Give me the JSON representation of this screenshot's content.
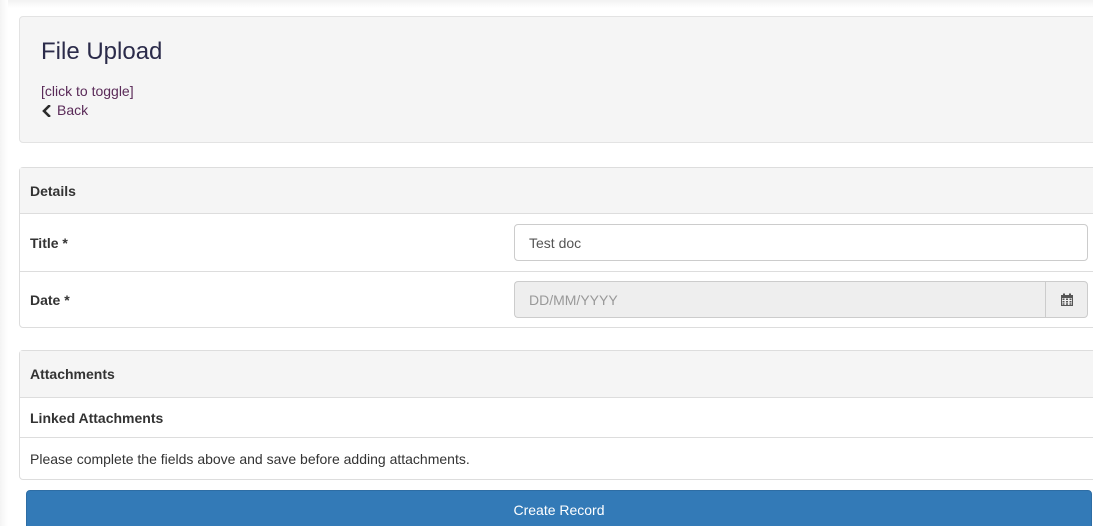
{
  "header": {
    "title": "File Upload",
    "toggle_label": "[click to toggle]",
    "back_label": "Back"
  },
  "details": {
    "heading": "Details",
    "title_label": "Title *",
    "title_value": "Test doc",
    "date_label": "Date *",
    "date_placeholder": "DD/MM/YYYY",
    "date_value": ""
  },
  "attachments": {
    "heading": "Attachments",
    "linked_heading": "Linked Attachments",
    "info_text": "Please complete the fields above and save before adding attachments."
  },
  "actions": {
    "create_label": "Create Record"
  },
  "icons": {
    "back": "chevron-left-icon",
    "date": "calendar-icon"
  },
  "colors": {
    "primary": "#337ab7",
    "link": "#5a2a58",
    "title": "#2b2b4a"
  }
}
